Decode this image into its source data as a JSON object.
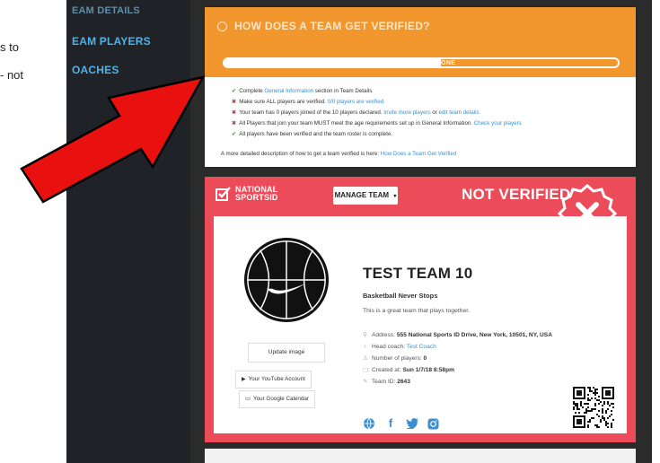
{
  "overlay": {
    "caption_line1": "s to",
    "caption_line2": "- not"
  },
  "sidebar": {
    "items": [
      {
        "label": "EAM DETAILS"
      },
      {
        "label": "EAM PLAYERS"
      },
      {
        "label": "OACHES"
      }
    ]
  },
  "verification": {
    "title": "HOW DOES A TEAM GET VERIFIED?",
    "progress_percent": 55,
    "progress_label": "55% DONE",
    "checklist": [
      {
        "status": "ok",
        "before": "Complete ",
        "link": "General Information",
        "after": " section in Team Details",
        "link2": "",
        "middle": ""
      },
      {
        "status": "bad",
        "before": "Make sure ALL players are verified. ",
        "link": "0/0 players are verified",
        "after": "",
        "link2": "",
        "middle": ""
      },
      {
        "status": "bad",
        "before": "Your team has 0 players joined of the 10 players declared. ",
        "link": "Invite more players",
        "middle": " or ",
        "link2": "edit team details",
        "after": ""
      },
      {
        "status": "bad",
        "before": "All Players that join your team MUST meet the age requirements set up in General Information. ",
        "link": "Check your players",
        "after": "",
        "link2": "",
        "middle": ""
      },
      {
        "status": "ok",
        "before": "All players have been verified and the team roster is complete.",
        "link": "",
        "after": "",
        "link2": "",
        "middle": ""
      }
    ],
    "description_text": "A more detailed description of how to get a team verified is here: ",
    "description_link": "How Does a Team Get Verified"
  },
  "team": {
    "brand_line1": "NATIONAL",
    "brand_line2": "SPORTSID",
    "manage_button": "MANAGE TEAM",
    "status": "NOT VERIFIED",
    "name": "TEST TEAM 10",
    "tagline": "Basketball Never Stops",
    "about": "This is a great team that plays together.",
    "update_image": "Update image",
    "youtube_button": "Your YouTube Account",
    "calendar_button": "Your Google Calendar",
    "address_label": "Address: ",
    "address": "555 National Sports ID Drive, New York, 10501, NY, USA",
    "coach_label": "Head coach: ",
    "coach": "Test Coach",
    "players_label": "Number of players: ",
    "players": "0",
    "created_label": "Created at: ",
    "created": "Sun 1/7/18 8:58pm",
    "id_label": "Team ID: ",
    "id": "2643"
  },
  "colors": {
    "orange": "#f2962e",
    "red": "#ec4c5a",
    "link_blue": "#3a8fd0",
    "arrow_red": "#e8110f"
  },
  "icons": [
    "check-icon",
    "cross-icon",
    "dropdown-caret-icon",
    "close-x-icon",
    "map-pin-icon",
    "whistle-icon",
    "user-icon",
    "calendar-icon",
    "tag-icon",
    "globe-icon",
    "facebook-icon",
    "twitter-icon",
    "instagram-icon",
    "youtube-icon",
    "qr-code"
  ]
}
